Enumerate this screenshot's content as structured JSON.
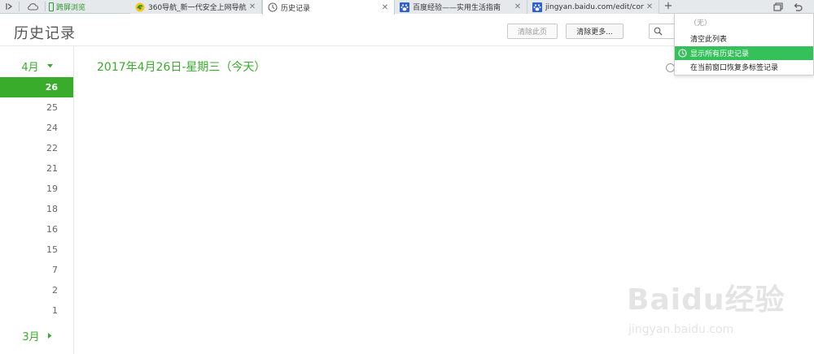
{
  "tabbar": {
    "screen_browse_label": "跨屏浏览",
    "tabs": [
      {
        "title": "360导航_新一代安全上网导航",
        "favicon": "360-icon"
      },
      {
        "title": "历史记录",
        "favicon": "clock-icon",
        "active": true
      },
      {
        "title": "百度经验——实用生活指南",
        "favicon": "baidu-paw-icon"
      },
      {
        "title": "jingyan.baidu.com/edit/conte",
        "favicon": "baidu-paw-icon"
      }
    ],
    "new_tab_label": "+"
  },
  "header": {
    "title": "历史记录",
    "clear_page_label": "清除此页",
    "clear_more_label": "清除更多..."
  },
  "calendar": {
    "current_month": "4月",
    "days": [
      "26",
      "25",
      "24",
      "22",
      "21",
      "19",
      "18",
      "16",
      "15",
      "7",
      "2",
      "1"
    ],
    "selected_day": "26",
    "prev_month": "3月"
  },
  "main": {
    "date_heading": "2017年4月26日-星期三（今天）"
  },
  "dropdown_menu": {
    "items": [
      "（无）",
      "清空此列表",
      "显示所有历史记录",
      "在当前窗口恢复多标签记录"
    ],
    "highlighted_index": 2
  },
  "watermark": {
    "logo_text": "Baidu经验",
    "url": "jingyan.baidu.com"
  },
  "colors": {
    "accent_green": "#3aac2c",
    "menu_highlight": "#34c15a"
  }
}
